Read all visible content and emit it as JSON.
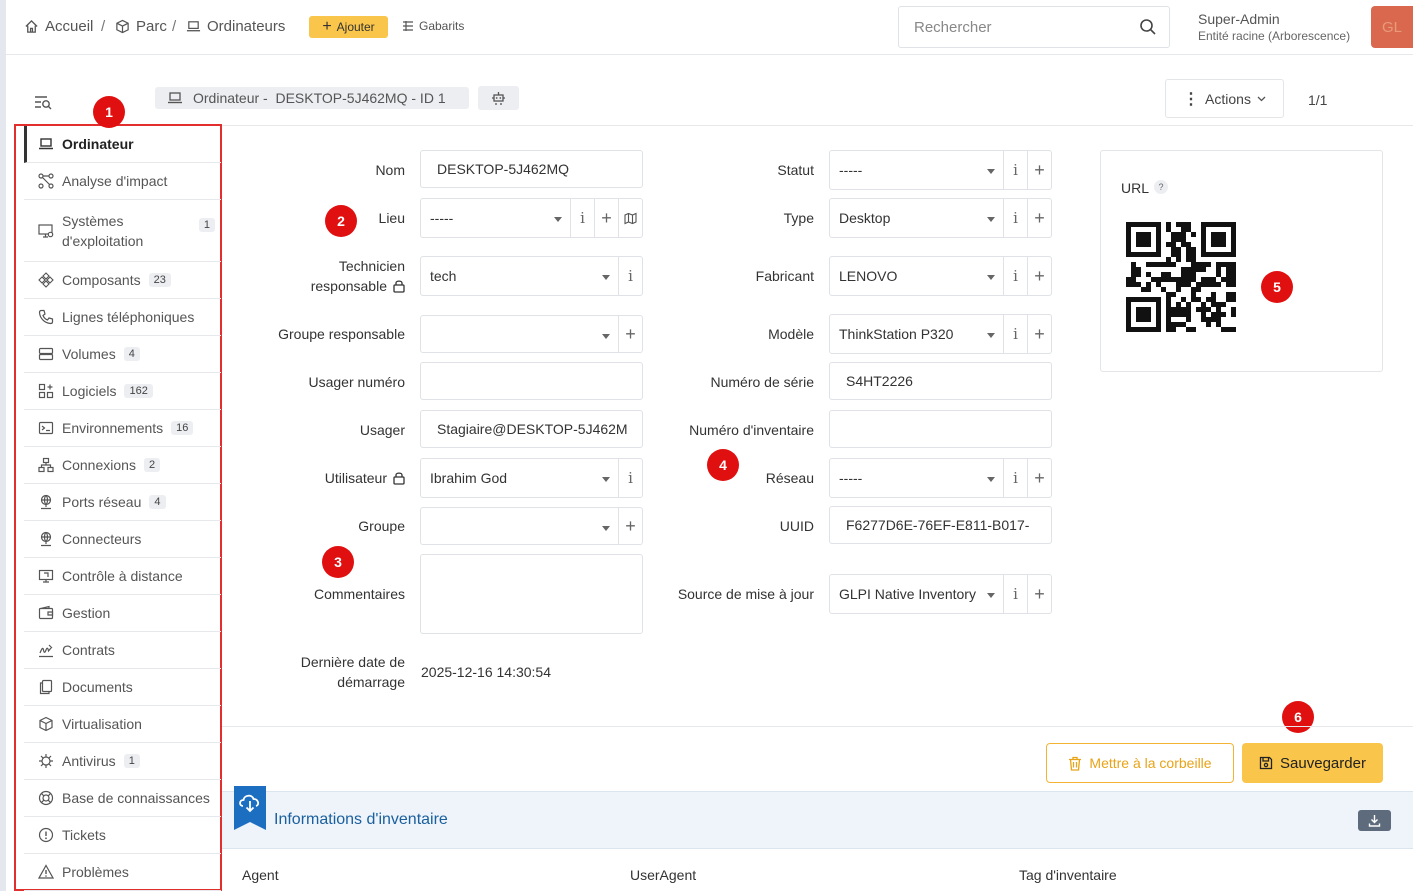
{
  "header": {
    "breadcrumb": [
      "Accueil",
      "Parc",
      "Ordinateurs"
    ],
    "add_label": "Ajouter",
    "templates_label": "Gabarits",
    "search_placeholder": "Rechercher",
    "user_name": "Super-Admin",
    "user_entity": "Entité racine (Arborescence)",
    "avatar_initials": "GL"
  },
  "subheader": {
    "item_title": "Ordinateur -  DESKTOP-5J462MQ - ID 1",
    "actions_label": "Actions",
    "pager": "1/1"
  },
  "sidebar": {
    "tabs": [
      {
        "label": "Ordinateur",
        "badge": null
      },
      {
        "label": "Analyse d'impact",
        "badge": null
      },
      {
        "label": "Systèmes d'exploitation",
        "badge": "1"
      },
      {
        "label": "Composants",
        "badge": "23"
      },
      {
        "label": "Lignes téléphoniques",
        "badge": null
      },
      {
        "label": "Volumes",
        "badge": "4"
      },
      {
        "label": "Logiciels",
        "badge": "162"
      },
      {
        "label": "Environnements",
        "badge": "16"
      },
      {
        "label": "Connexions",
        "badge": "2"
      },
      {
        "label": "Ports réseau",
        "badge": "4"
      },
      {
        "label": "Connecteurs",
        "badge": null
      },
      {
        "label": "Contrôle à distance",
        "badge": null
      },
      {
        "label": "Gestion",
        "badge": null
      },
      {
        "label": "Contrats",
        "badge": null
      },
      {
        "label": "Documents",
        "badge": null
      },
      {
        "label": "Virtualisation",
        "badge": null
      },
      {
        "label": "Antivirus",
        "badge": "1"
      },
      {
        "label": "Base de connaissances",
        "badge": null
      },
      {
        "label": "Tickets",
        "badge": null
      },
      {
        "label": "Problèmes",
        "badge": null
      }
    ]
  },
  "form": {
    "nom": {
      "label": "Nom",
      "value": "DESKTOP-5J462MQ"
    },
    "lieu": {
      "label": "Lieu",
      "value": "-----"
    },
    "technicien": {
      "label_line1": "Technicien",
      "label_line2": "responsable",
      "value": "tech"
    },
    "groupe_resp": {
      "label": "Groupe responsable",
      "value": ""
    },
    "usager_num": {
      "label": "Usager numéro",
      "value": ""
    },
    "usager": {
      "label": "Usager",
      "value": "Stagiaire@DESKTOP-5J462M"
    },
    "utilisateur": {
      "label": "Utilisateur",
      "value": "Ibrahim God"
    },
    "groupe": {
      "label": "Groupe",
      "value": ""
    },
    "commentaires": {
      "label": "Commentaires",
      "value": ""
    },
    "derniere_date": {
      "label_line1": "Dernière date de",
      "label_line2": "démarrage",
      "value": "2025-12-16 14:30:54"
    },
    "statut": {
      "label": "Statut",
      "value": "-----"
    },
    "type": {
      "label": "Type",
      "value": "Desktop"
    },
    "fabricant": {
      "label": "Fabricant",
      "value": "LENOVO"
    },
    "modele": {
      "label": "Modèle",
      "value": "ThinkStation P320"
    },
    "numero_serie": {
      "label": "Numéro de série",
      "value": "S4HT2226"
    },
    "numero_inventaire": {
      "label": "Numéro d'inventaire",
      "value": ""
    },
    "reseau": {
      "label": "Réseau",
      "value": "-----"
    },
    "uuid": {
      "label": "UUID",
      "value": "F6277D6E-76EF-E811-B017-"
    },
    "source": {
      "label": "Source de mise à jour",
      "value": "GLPI Native Inventory"
    }
  },
  "qr": {
    "label": "URL",
    "help": "?"
  },
  "buttons": {
    "trash": "Mettre à la corbeille",
    "save": "Sauvegarder"
  },
  "inventory": {
    "title": "Informations d'inventaire",
    "columns": [
      "Agent",
      "UserAgent",
      "Tag d'inventaire"
    ]
  },
  "markers": [
    "1",
    "2",
    "3",
    "4",
    "5",
    "6"
  ],
  "colors": {
    "accent": "#f9c54a",
    "marker": "#e01010",
    "link": "#1a5f9e"
  }
}
